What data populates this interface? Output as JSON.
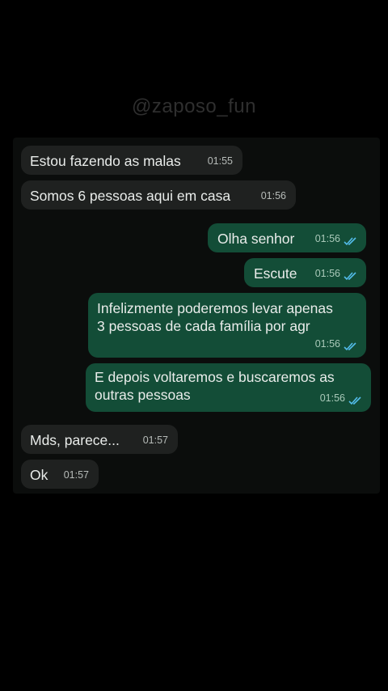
{
  "watermark": "@zaposo_fun",
  "colors": {
    "background": "#000000",
    "incoming_bubble": "#1f2120",
    "outgoing_bubble": "#134d37",
    "read_ticks": "#53bdeb"
  },
  "messages": [
    {
      "direction": "incoming",
      "text": "Estou fazendo as malas",
      "time": "01:55"
    },
    {
      "direction": "incoming",
      "text": "Somos 6 pessoas aqui em casa",
      "time": "01:56"
    },
    {
      "direction": "outgoing",
      "text": "Olha senhor",
      "time": "01:56",
      "status_icon": "double-check-read-icon"
    },
    {
      "direction": "outgoing",
      "text": "Escute",
      "time": "01:56",
      "status_icon": "double-check-read-icon"
    },
    {
      "direction": "outgoing",
      "text_lines": [
        "Infelizmente poderemos levar apenas",
        "3 pessoas de cada família por agr"
      ],
      "time": "01:56",
      "status_icon": "double-check-read-icon"
    },
    {
      "direction": "outgoing",
      "text_lines": [
        "E depois voltaremos e buscaremos as",
        "outras pessoas"
      ],
      "time": "01:56",
      "status_icon": "double-check-read-icon"
    },
    {
      "direction": "incoming",
      "text": "Mds, parece...",
      "time": "01:57"
    },
    {
      "direction": "incoming",
      "text": "Ok",
      "time": "01:57"
    }
  ]
}
